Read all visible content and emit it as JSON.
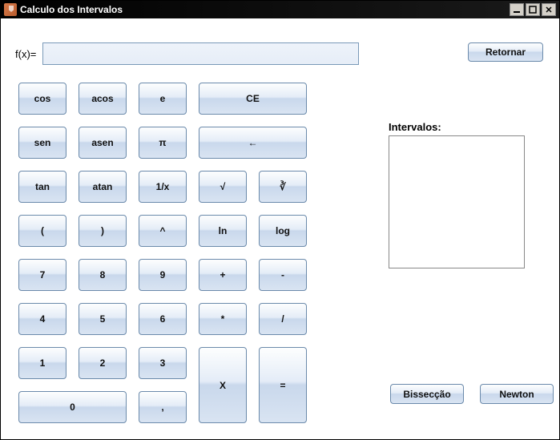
{
  "window": {
    "title": "Calculo dos Intervalos"
  },
  "fx": {
    "label": "f(x)=",
    "value": ""
  },
  "buttons": {
    "return": "Retornar",
    "bisseccao": "Bissecção",
    "newton": "Newton"
  },
  "intervals": {
    "label": "Intervalos:"
  },
  "keys": {
    "cos": "cos",
    "acos": "acos",
    "e": "e",
    "CE": "CE",
    "sen": "sen",
    "asen": "asen",
    "pi": "π",
    "back": "←",
    "tan": "tan",
    "atan": "atan",
    "inv": "1/x",
    "sqrt": "√",
    "cbrt": "∛",
    "lpar": "(",
    "rpar": ")",
    "pow": "^",
    "ln": "ln",
    "log": "log",
    "n7": "7",
    "n8": "8",
    "n9": "9",
    "plus": "+",
    "minus": "-",
    "n4": "4",
    "n5": "5",
    "n6": "6",
    "mul": "*",
    "div": "/",
    "n1": "1",
    "n2": "2",
    "n3": "3",
    "X": "X",
    "eq": "=",
    "n0": "0",
    "comma": ","
  }
}
